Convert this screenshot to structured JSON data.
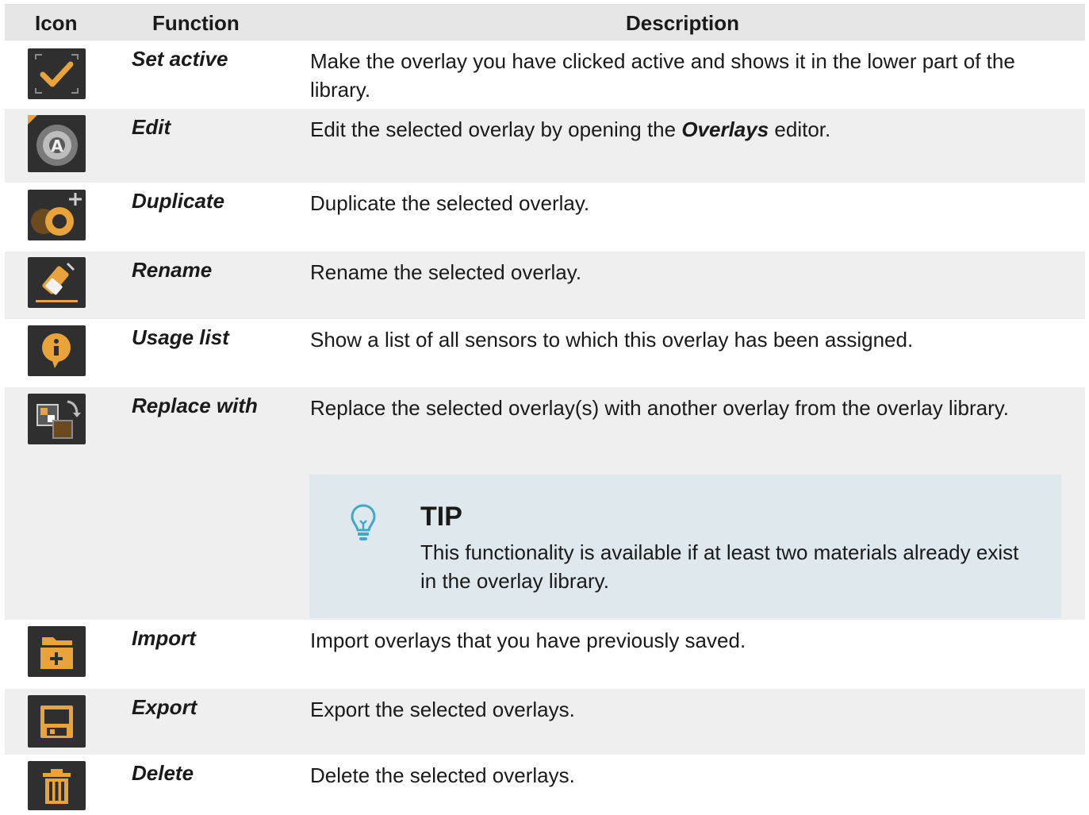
{
  "header": {
    "icon": "Icon",
    "function": "Function",
    "description": "Description"
  },
  "rows": [
    {
      "icon": "set-active-icon",
      "function": "Set active",
      "description": "Make the overlay you have clicked active and shows it in the lower part of the library."
    },
    {
      "icon": "edit-icon",
      "function": "Edit",
      "description_pre": "Edit the selected overlay by opening the ",
      "description_bold": "Overlays",
      "description_post": " editor."
    },
    {
      "icon": "duplicate-icon",
      "function": "Duplicate",
      "description": "Duplicate the selected overlay."
    },
    {
      "icon": "rename-icon",
      "function": "Rename",
      "description": "Rename the selected overlay."
    },
    {
      "icon": "usage-list-icon",
      "function": "Usage list",
      "description": "Show a list of all sensors to which this overlay has been assigned."
    },
    {
      "icon": "replace-with-icon",
      "function": "Replace with",
      "description": "Replace the selected overlay(s) with another overlay from the overlay library."
    },
    {
      "icon": "import-icon",
      "function": "Import",
      "description": "Import overlays that you have previously saved."
    },
    {
      "icon": "export-icon",
      "function": "Export",
      "description": "Export the selected overlays."
    },
    {
      "icon": "delete-icon",
      "function": "Delete",
      "description": "Delete the selected overlays."
    }
  ],
  "tip": {
    "icon": "lightbulb-icon",
    "title": "TIP",
    "text": "This functionality is available if at least two materials already exist in the overlay library."
  },
  "colors": {
    "icon_bg": "#2f2f2f",
    "icon_accent": "#e8a33a",
    "tip_bg": "#dfe9ed",
    "tip_icon": "#3fa9c9"
  }
}
